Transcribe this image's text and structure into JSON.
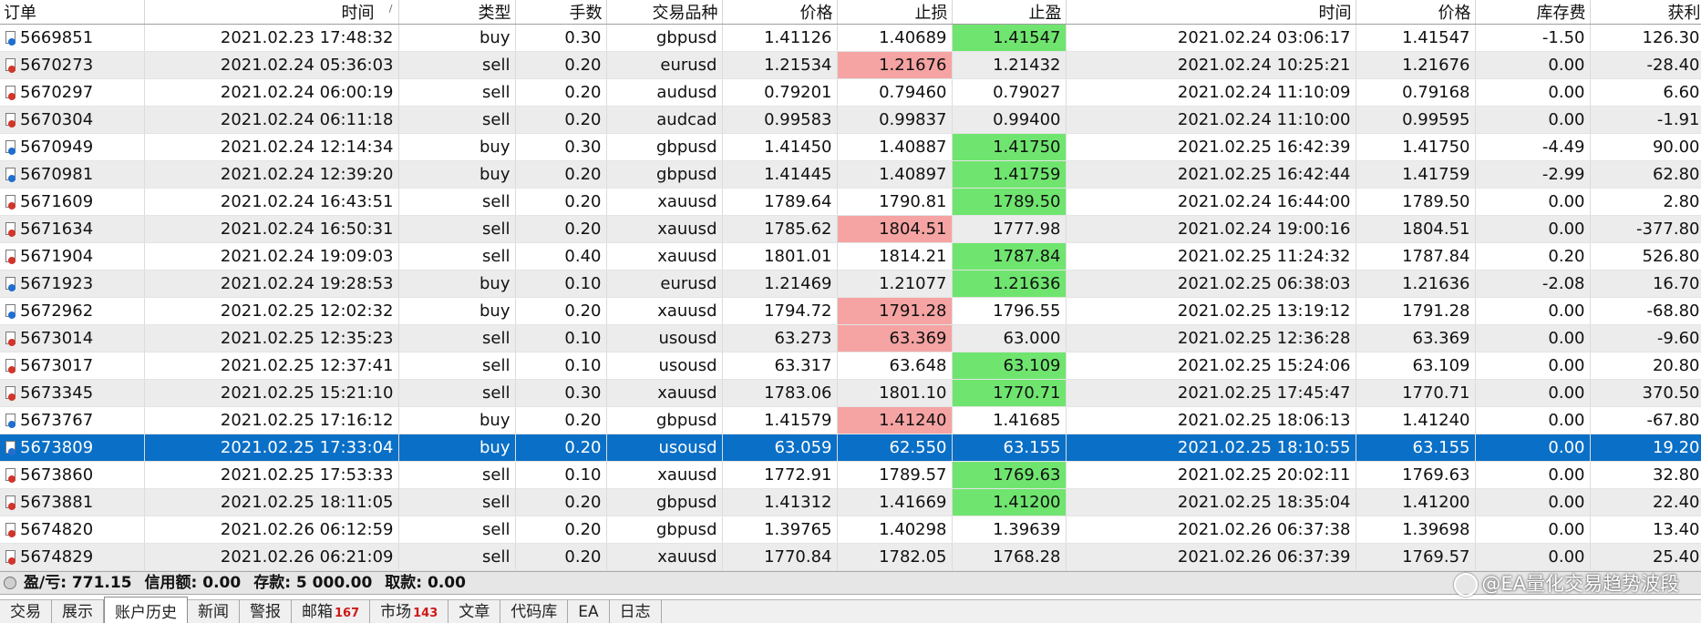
{
  "columns": [
    "订单",
    "时间",
    "类型",
    "手数",
    "交易品种",
    "价格",
    "止损",
    "止盈",
    "时间",
    "价格",
    "库存费",
    "获利"
  ],
  "sort_indicator": "/",
  "rows": [
    {
      "order": "5669851",
      "open_time": "2021.02.23 17:48:32",
      "type": "buy",
      "lots": "0.30",
      "symbol": "gbpusd",
      "price": "1.41126",
      "sl": "1.40689",
      "tp": "1.41547",
      "close_time": "2021.02.24 03:06:17",
      "close_price": "1.41547",
      "swap": "-1.50",
      "profit": "126.30",
      "sl_hl": "",
      "tp_hl": "green",
      "selected": false
    },
    {
      "order": "5670273",
      "open_time": "2021.02.24 05:36:03",
      "type": "sell",
      "lots": "0.20",
      "symbol": "eurusd",
      "price": "1.21534",
      "sl": "1.21676",
      "tp": "1.21432",
      "close_time": "2021.02.24 10:25:21",
      "close_price": "1.21676",
      "swap": "0.00",
      "profit": "-28.40",
      "sl_hl": "red",
      "tp_hl": "",
      "selected": false
    },
    {
      "order": "5670297",
      "open_time": "2021.02.24 06:00:19",
      "type": "sell",
      "lots": "0.20",
      "symbol": "audusd",
      "price": "0.79201",
      "sl": "0.79460",
      "tp": "0.79027",
      "close_time": "2021.02.24 11:10:09",
      "close_price": "0.79168",
      "swap": "0.00",
      "profit": "6.60",
      "sl_hl": "",
      "tp_hl": "",
      "selected": false
    },
    {
      "order": "5670304",
      "open_time": "2021.02.24 06:11:18",
      "type": "sell",
      "lots": "0.20",
      "symbol": "audcad",
      "price": "0.99583",
      "sl": "0.99837",
      "tp": "0.99400",
      "close_time": "2021.02.24 11:10:00",
      "close_price": "0.99595",
      "swap": "0.00",
      "profit": "-1.91",
      "sl_hl": "",
      "tp_hl": "",
      "selected": false
    },
    {
      "order": "5670949",
      "open_time": "2021.02.24 12:14:34",
      "type": "buy",
      "lots": "0.30",
      "symbol": "gbpusd",
      "price": "1.41450",
      "sl": "1.40887",
      "tp": "1.41750",
      "close_time": "2021.02.25 16:42:39",
      "close_price": "1.41750",
      "swap": "-4.49",
      "profit": "90.00",
      "sl_hl": "",
      "tp_hl": "green",
      "selected": false
    },
    {
      "order": "5670981",
      "open_time": "2021.02.24 12:39:20",
      "type": "buy",
      "lots": "0.20",
      "symbol": "gbpusd",
      "price": "1.41445",
      "sl": "1.40897",
      "tp": "1.41759",
      "close_time": "2021.02.25 16:42:44",
      "close_price": "1.41759",
      "swap": "-2.99",
      "profit": "62.80",
      "sl_hl": "",
      "tp_hl": "green",
      "selected": false
    },
    {
      "order": "5671609",
      "open_time": "2021.02.24 16:43:51",
      "type": "sell",
      "lots": "0.20",
      "symbol": "xauusd",
      "price": "1789.64",
      "sl": "1790.81",
      "tp": "1789.50",
      "close_time": "2021.02.24 16:44:00",
      "close_price": "1789.50",
      "swap": "0.00",
      "profit": "2.80",
      "sl_hl": "",
      "tp_hl": "green",
      "selected": false
    },
    {
      "order": "5671634",
      "open_time": "2021.02.24 16:50:31",
      "type": "sell",
      "lots": "0.20",
      "symbol": "xauusd",
      "price": "1785.62",
      "sl": "1804.51",
      "tp": "1777.98",
      "close_time": "2021.02.24 19:00:16",
      "close_price": "1804.51",
      "swap": "0.00",
      "profit": "-377.80",
      "sl_hl": "red",
      "tp_hl": "",
      "selected": false
    },
    {
      "order": "5671904",
      "open_time": "2021.02.24 19:09:03",
      "type": "sell",
      "lots": "0.40",
      "symbol": "xauusd",
      "price": "1801.01",
      "sl": "1814.21",
      "tp": "1787.84",
      "close_time": "2021.02.25 11:24:32",
      "close_price": "1787.84",
      "swap": "0.20",
      "profit": "526.80",
      "sl_hl": "",
      "tp_hl": "green",
      "selected": false
    },
    {
      "order": "5671923",
      "open_time": "2021.02.24 19:28:53",
      "type": "buy",
      "lots": "0.10",
      "symbol": "eurusd",
      "price": "1.21469",
      "sl": "1.21077",
      "tp": "1.21636",
      "close_time": "2021.02.25 06:38:03",
      "close_price": "1.21636",
      "swap": "-2.08",
      "profit": "16.70",
      "sl_hl": "",
      "tp_hl": "green",
      "selected": false
    },
    {
      "order": "5672962",
      "open_time": "2021.02.25 12:02:32",
      "type": "buy",
      "lots": "0.20",
      "symbol": "xauusd",
      "price": "1794.72",
      "sl": "1791.28",
      "tp": "1796.55",
      "close_time": "2021.02.25 13:19:12",
      "close_price": "1791.28",
      "swap": "0.00",
      "profit": "-68.80",
      "sl_hl": "red",
      "tp_hl": "",
      "selected": false
    },
    {
      "order": "5673014",
      "open_time": "2021.02.25 12:35:23",
      "type": "sell",
      "lots": "0.10",
      "symbol": "usousd",
      "price": "63.273",
      "sl": "63.369",
      "tp": "63.000",
      "close_time": "2021.02.25 12:36:28",
      "close_price": "63.369",
      "swap": "0.00",
      "profit": "-9.60",
      "sl_hl": "red",
      "tp_hl": "",
      "selected": false
    },
    {
      "order": "5673017",
      "open_time": "2021.02.25 12:37:41",
      "type": "sell",
      "lots": "0.10",
      "symbol": "usousd",
      "price": "63.317",
      "sl": "63.648",
      "tp": "63.109",
      "close_time": "2021.02.25 15:24:06",
      "close_price": "63.109",
      "swap": "0.00",
      "profit": "20.80",
      "sl_hl": "",
      "tp_hl": "green",
      "selected": false
    },
    {
      "order": "5673345",
      "open_time": "2021.02.25 15:21:10",
      "type": "sell",
      "lots": "0.30",
      "symbol": "xauusd",
      "price": "1783.06",
      "sl": "1801.10",
      "tp": "1770.71",
      "close_time": "2021.02.25 17:45:47",
      "close_price": "1770.71",
      "swap": "0.00",
      "profit": "370.50",
      "sl_hl": "",
      "tp_hl": "green",
      "selected": false
    },
    {
      "order": "5673767",
      "open_time": "2021.02.25 17:16:12",
      "type": "buy",
      "lots": "0.20",
      "symbol": "gbpusd",
      "price": "1.41579",
      "sl": "1.41240",
      "tp": "1.41685",
      "close_time": "2021.02.25 18:06:13",
      "close_price": "1.41240",
      "swap": "0.00",
      "profit": "-67.80",
      "sl_hl": "red",
      "tp_hl": "",
      "selected": false
    },
    {
      "order": "5673809",
      "open_time": "2021.02.25 17:33:04",
      "type": "buy",
      "lots": "0.20",
      "symbol": "usousd",
      "price": "63.059",
      "sl": "62.550",
      "tp": "63.155",
      "close_time": "2021.02.25 18:10:55",
      "close_price": "63.155",
      "swap": "0.00",
      "profit": "19.20",
      "sl_hl": "",
      "tp_hl": "green",
      "selected": true
    },
    {
      "order": "5673860",
      "open_time": "2021.02.25 17:53:33",
      "type": "sell",
      "lots": "0.10",
      "symbol": "xauusd",
      "price": "1772.91",
      "sl": "1789.57",
      "tp": "1769.63",
      "close_time": "2021.02.25 20:02:11",
      "close_price": "1769.63",
      "swap": "0.00",
      "profit": "32.80",
      "sl_hl": "",
      "tp_hl": "green",
      "selected": false
    },
    {
      "order": "5673881",
      "open_time": "2021.02.25 18:11:05",
      "type": "sell",
      "lots": "0.20",
      "symbol": "gbpusd",
      "price": "1.41312",
      "sl": "1.41669",
      "tp": "1.41200",
      "close_time": "2021.02.25 18:35:04",
      "close_price": "1.41200",
      "swap": "0.00",
      "profit": "22.40",
      "sl_hl": "",
      "tp_hl": "green",
      "selected": false
    },
    {
      "order": "5674820",
      "open_time": "2021.02.26 06:12:59",
      "type": "sell",
      "lots": "0.20",
      "symbol": "gbpusd",
      "price": "1.39765",
      "sl": "1.40298",
      "tp": "1.39639",
      "close_time": "2021.02.26 06:37:38",
      "close_price": "1.39698",
      "swap": "0.00",
      "profit": "13.40",
      "sl_hl": "",
      "tp_hl": "",
      "selected": false
    },
    {
      "order": "5674829",
      "open_time": "2021.02.26 06:21:09",
      "type": "sell",
      "lots": "0.20",
      "symbol": "xauusd",
      "price": "1770.84",
      "sl": "1782.05",
      "tp": "1768.28",
      "close_time": "2021.02.26 06:37:39",
      "close_price": "1769.57",
      "swap": "0.00",
      "profit": "25.40",
      "sl_hl": "",
      "tp_hl": "",
      "selected": false
    }
  ],
  "summary": {
    "pl": "盈/亏: 771.15",
    "credit": "信用额: 0.00",
    "deposit": "存款: 5 000.00",
    "withdrawal": "取款: 0.00"
  },
  "watermark": "@EA量化交易趋势波段",
  "tabs": [
    {
      "label": "交易",
      "badge": "",
      "active": false
    },
    {
      "label": "展示",
      "badge": "",
      "active": false
    },
    {
      "label": "账户历史",
      "badge": "",
      "active": true
    },
    {
      "label": "新闻",
      "badge": "",
      "active": false
    },
    {
      "label": "警报",
      "badge": "",
      "active": false
    },
    {
      "label": "邮箱",
      "badge": "167",
      "active": false
    },
    {
      "label": "市场",
      "badge": "143",
      "active": false
    },
    {
      "label": "文章",
      "badge": "",
      "active": false
    },
    {
      "label": "代码库",
      "badge": "",
      "active": false
    },
    {
      "label": "EA",
      "badge": "",
      "active": false
    },
    {
      "label": "日志",
      "badge": "",
      "active": false
    }
  ],
  "colors": {
    "selected_row": "#0a6fc6",
    "stop_loss_hit": "#f5a3a3",
    "take_profit_hit": "#6fe56f",
    "buy_icon": "#1f6fd1",
    "sell_icon": "#d2352a"
  }
}
